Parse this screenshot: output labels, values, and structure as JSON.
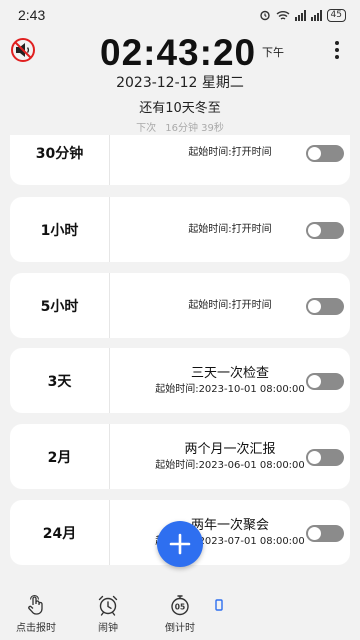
{
  "status_bar": {
    "time": "2:43",
    "signal1": "⁴⁶",
    "signal2": "²⁰",
    "battery": "45"
  },
  "header": {
    "clock": "02:43:20",
    "ampm": "下午",
    "date": "2023-12-12 星期二",
    "solar_term": "还有10天冬至",
    "next_label": "下次",
    "next_time": "16分钟 39秒"
  },
  "cards": [
    {
      "interval": "30分钟",
      "title": "",
      "start": "起始时间:打开时间",
      "enabled": false
    },
    {
      "interval": "1小时",
      "title": "",
      "start": "起始时间:打开时间",
      "enabled": false
    },
    {
      "interval": "5小时",
      "title": "",
      "start": "起始时间:打开时间",
      "enabled": false
    },
    {
      "interval": "3天",
      "title": "三天一次检查",
      "start": "起始时间:2023-10-01 08:00:00",
      "enabled": false
    },
    {
      "interval": "2月",
      "title": "两个月一次汇报",
      "start": "起始时间:2023-06-01 08:00:00",
      "enabled": false
    },
    {
      "interval": "24月",
      "title": "两年一次聚会",
      "start": "起始时间:2023-07-01 08:00:00",
      "enabled": false
    }
  ],
  "tabs": [
    {
      "label": "点击报时",
      "icon": "tap-hand-icon"
    },
    {
      "label": "闹钟",
      "icon": "alarm-clock-icon"
    },
    {
      "label": "倒计时",
      "icon": "countdown-timer-icon"
    },
    {
      "label": "",
      "icon": "partial-tab-icon"
    }
  ],
  "colors": {
    "accent": "#2e6ff0",
    "toggle_off": "#8b8b8b",
    "background": "#f2f2f2"
  }
}
